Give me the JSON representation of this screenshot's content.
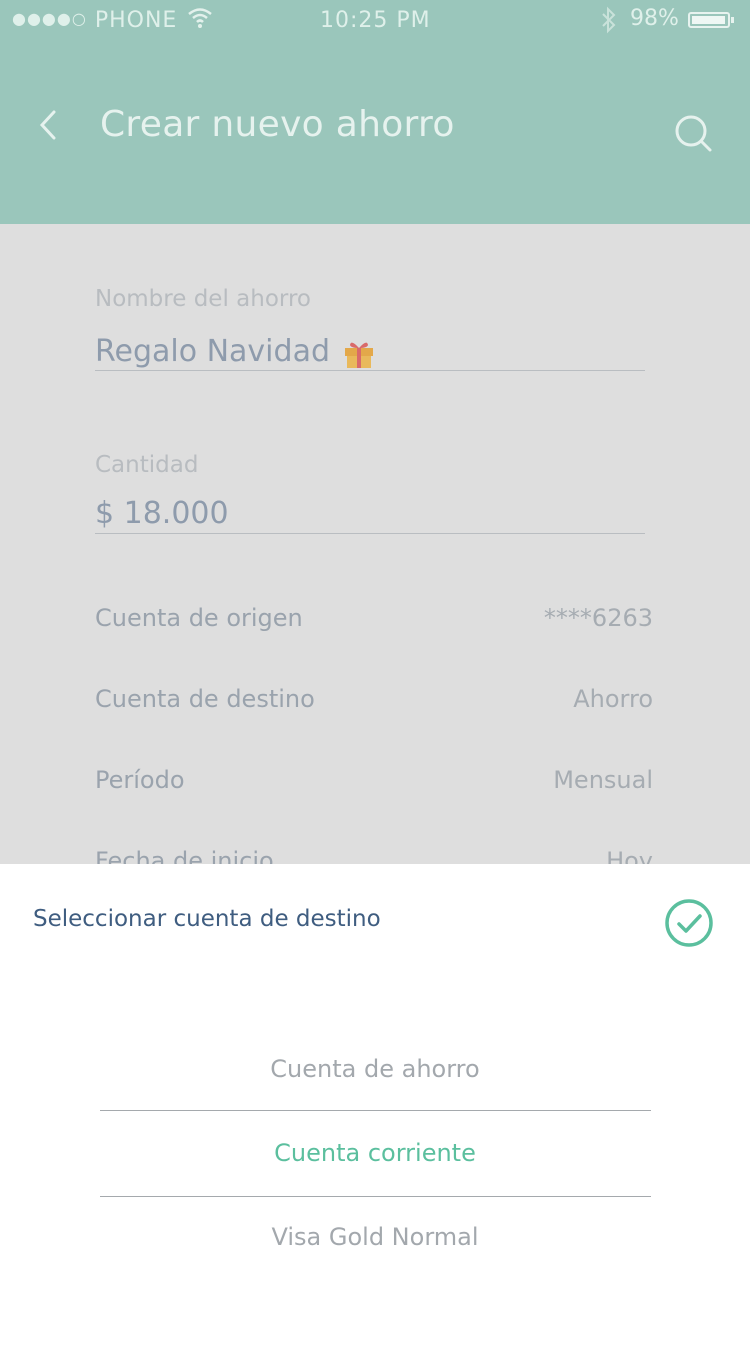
{
  "status_bar": {
    "signal_dots": "●●●●○",
    "carrier": "PHONE",
    "time": "10:25 PM",
    "battery": "98%",
    "battery_level": 0.98
  },
  "header": {
    "title": "Crear nuevo ahorro",
    "back_icon": "chevron-left-icon",
    "search_icon": "search-icon"
  },
  "form": {
    "name": {
      "label": "Nombre del ahorro",
      "value": "Regalo Navidad",
      "icon": "gift-icon"
    },
    "amount": {
      "label": "Cantidad",
      "value": "$ 18.000"
    },
    "rows": [
      {
        "label": "Cuenta de origen",
        "value": "****6263"
      },
      {
        "label": "Cuenta de destino",
        "value": "Ahorro"
      },
      {
        "label": "Período",
        "value": "Mensual"
      },
      {
        "label": "Fecha de inicio",
        "value": "Hoy"
      }
    ]
  },
  "sheet": {
    "title": "Seleccionar cuenta de destino",
    "confirm_icon": "check-circle-icon",
    "options": [
      {
        "label": "Cuenta de ahorro",
        "selected": false
      },
      {
        "label": "Cuenta corriente",
        "selected": true
      },
      {
        "label": "Visa Gold Normal",
        "selected": false
      }
    ]
  },
  "colors": {
    "header": "#9ac6bb",
    "accent": "#5bbf9e",
    "sheet_title": "#3f5d80",
    "overlay_bg": "#dedede"
  }
}
